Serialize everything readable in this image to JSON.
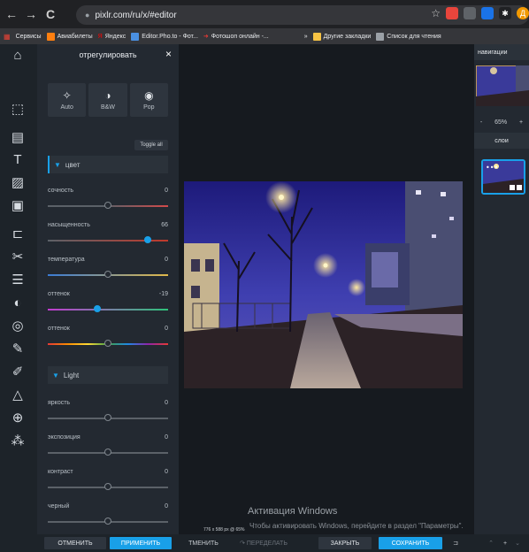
{
  "browser": {
    "back": "←",
    "forward": "→",
    "reload": "C",
    "url": "pixlr.com/ru/x/#editor",
    "star": "☆"
  },
  "bookmarks": [
    {
      "label": "Сервисы",
      "color": "#e94235"
    },
    {
      "label": "Авиабилеты",
      "color": "#ff7f0f"
    },
    {
      "label": "Яндекс",
      "color": "#ff0000"
    },
    {
      "label": "Editor.Pho.to - Фот...",
      "color": "#4a90e2"
    },
    {
      "label": "Фотошоп онлайн -...",
      "color": "#e53935"
    },
    {
      "label": "»",
      "color": ""
    },
    {
      "label": "Другие закладки",
      "color": "#f6c344"
    },
    {
      "label": "Список для чтения",
      "color": "#9aa0a6"
    }
  ],
  "panel": {
    "title": "отрегулировать",
    "close": "×",
    "quick": [
      {
        "label": "Auto",
        "icon": "magic-wand-icon",
        "glyph": "✧"
      },
      {
        "label": "B&W",
        "icon": "contrast-icon",
        "glyph": "◑"
      },
      {
        "label": "Pop",
        "icon": "pop-icon",
        "glyph": "◉"
      }
    ],
    "toggle_all": "Toggle all",
    "color_section": "цвет",
    "light_section": "Light",
    "sliders_color": [
      {
        "label": "сочность",
        "value": "0",
        "fraction": 0.5,
        "gradient": "linear-gradient(90deg,#5b6168,#5b6168 48%,#d24a4a)"
      },
      {
        "label": "насыщенность",
        "value": "66",
        "fraction": 0.83,
        "gradient": "linear-gradient(90deg,#5b6168,#c0392b)"
      },
      {
        "label": "температура",
        "value": "0",
        "fraction": 0.5,
        "gradient": "linear-gradient(90deg,#3a7bd5,#e0b84a)"
      },
      {
        "label": "оттенок",
        "value": "-19",
        "fraction": 0.41,
        "gradient": "linear-gradient(90deg,#c23bd0,#2ec27a)"
      },
      {
        "label": "оттенок",
        "value": "0",
        "fraction": 0.5,
        "gradient": "linear-gradient(90deg,#e53935,#fb8c00,#fdd835,#43a047,#1e88e5,#8e24aa,#e53935)"
      }
    ],
    "sliders_light": [
      {
        "label": "яркость",
        "value": "0",
        "fraction": 0.5
      },
      {
        "label": "экспозиция",
        "value": "0",
        "fraction": 0.5
      },
      {
        "label": "контраст",
        "value": "0",
        "fraction": 0.5
      },
      {
        "label": "черный",
        "value": "0",
        "fraction": 0.5
      }
    ]
  },
  "right": {
    "nav_title": "навигации",
    "zoom_minus": "-",
    "zoom": "65%",
    "zoom_plus": "+",
    "layers_title": "слои"
  },
  "canvas": {
    "dims": "776 x 588 px @ 65%",
    "activation_title": "Активация Windows",
    "activation_sub": "Чтобы активировать Windows, перейдите в раздел \"Параметры\"."
  },
  "bottom": {
    "cancel": "ОТМЕНИТЬ",
    "apply": "ПРИМЕНИТЬ",
    "undo": "ТМЕНИТЬ",
    "redo": "↷ ПЕРЕДЕЛАТЬ",
    "close": "ЗАКРЫТЬ",
    "save": "СОХРАНИТЬ"
  },
  "colors": {
    "accent": "#19a0e8",
    "knob": "#19a0e8"
  }
}
